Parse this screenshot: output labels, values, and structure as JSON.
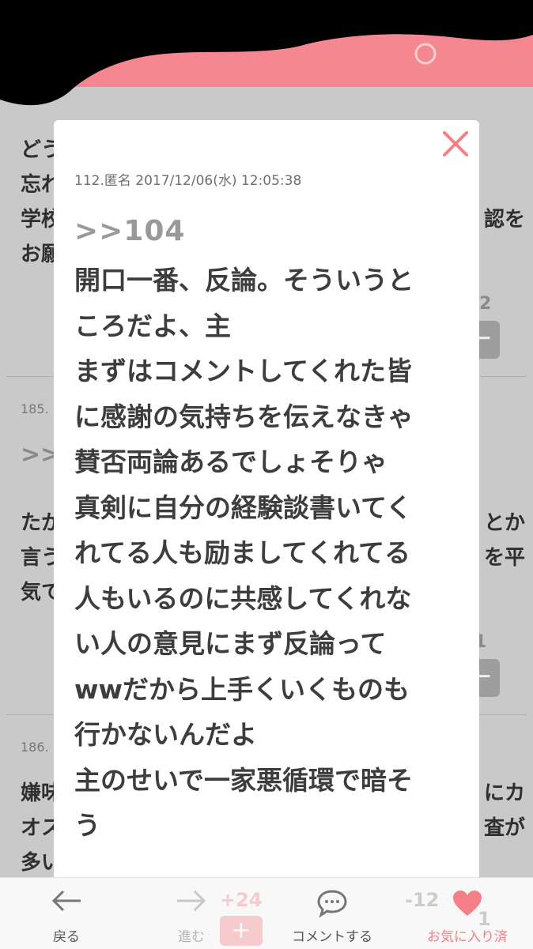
{
  "colors": {
    "accent": "#f4878f",
    "favorite": "#f47f87",
    "modal_bg": "#ffffff",
    "overlay": "#c9c9c9"
  },
  "feed": {
    "post1_lines": [
      "どう",
      "忘れ",
      "学校",
      "お願"
    ],
    "post1_right_fragment": "認を",
    "post1_count_fragment": "2",
    "post2_meta": "185.",
    "post2_anchor": ">>",
    "post2_lines": [
      "たか",
      "言う",
      "気て"
    ],
    "post2_right_lines": [
      "とか",
      "を平"
    ],
    "post2_count_fragment": "1",
    "post3_meta": "186.",
    "post3_lines": [
      "嫌味",
      "オス",
      "多い"
    ],
    "post3_right_lines": [
      "にカ",
      "査が"
    ]
  },
  "modal": {
    "meta": "112.匿名 2017/12/06(水) 12:05:38",
    "anchor": ">>104",
    "body_lines": [
      "開口一番、反論。そういうと",
      "ころだよ、主",
      "まずはコメントしてくれた皆",
      "に感謝の気持ちを伝えなきゃ",
      "賛否両論あるでしょそりゃ",
      "真剣に自分の経験談書いてく",
      "れてる人も励ましてくれてる",
      "人もいるのに共感してくれな",
      "い人の意見にまず反論って",
      "wwだから上手くいくものも",
      "行かないんだよ",
      "主のせいで一家悪循環で暗そ",
      "う"
    ],
    "close_icon": "close-icon"
  },
  "toolbar": {
    "back_label": "戻る",
    "forward_label": "進む",
    "comment_label": "コメントする",
    "favorite_label": "お気に入り済",
    "ghost_plus": "+24",
    "ghost_minus": "-12",
    "ghost_one": "1"
  }
}
